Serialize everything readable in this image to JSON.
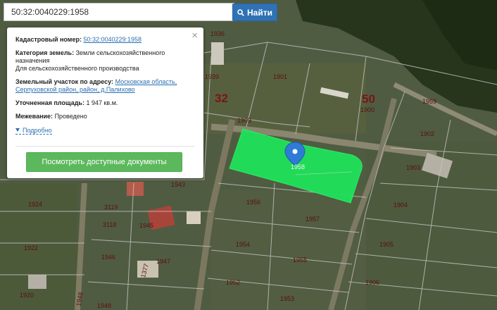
{
  "search": {
    "value": "50:32:0040229:1958",
    "button_label": "Найти"
  },
  "popup": {
    "close_label": "×",
    "cadastral_label": "Кадастровый номер:",
    "cadastral_value": "50:32:0040229:1958",
    "category_label": "Категория земель:",
    "category_value_1": "Земли сельскохозяйственного",
    "category_value_2": "назначения",
    "category_value_3": "Для сельскохозяйственного производства",
    "address_label": "Земельный участок по адресу:",
    "address_part_1": "Московская область,",
    "address_part_2": "Серпуховской район, район, д.Палихово",
    "area_label": "Уточненная площадь:",
    "area_value": "1 947 кв.м.",
    "survey_label": "Межевание:",
    "survey_value": "Проведено",
    "more_label": "Подробно",
    "docs_button_label": "Посмотреть доступные документы"
  },
  "map": {
    "big_labels": [
      "32",
      "50"
    ],
    "marker_label": "1958",
    "parcel_labels": [
      "1936",
      "1937",
      "1939",
      "1901",
      "1909",
      "1900",
      "1959",
      "1902",
      "1903",
      "1943",
      "1956",
      "1957",
      "1904",
      "1924",
      "3119",
      "3118",
      "1945",
      "1954",
      "1905",
      "1922",
      "1946",
      "1947",
      "1377",
      "1955",
      "1952",
      "1906",
      "1920",
      "1948",
      "1948",
      "1953"
    ],
    "highlight_color": "#1fe05a",
    "marker_color": "#2f7bd6"
  }
}
